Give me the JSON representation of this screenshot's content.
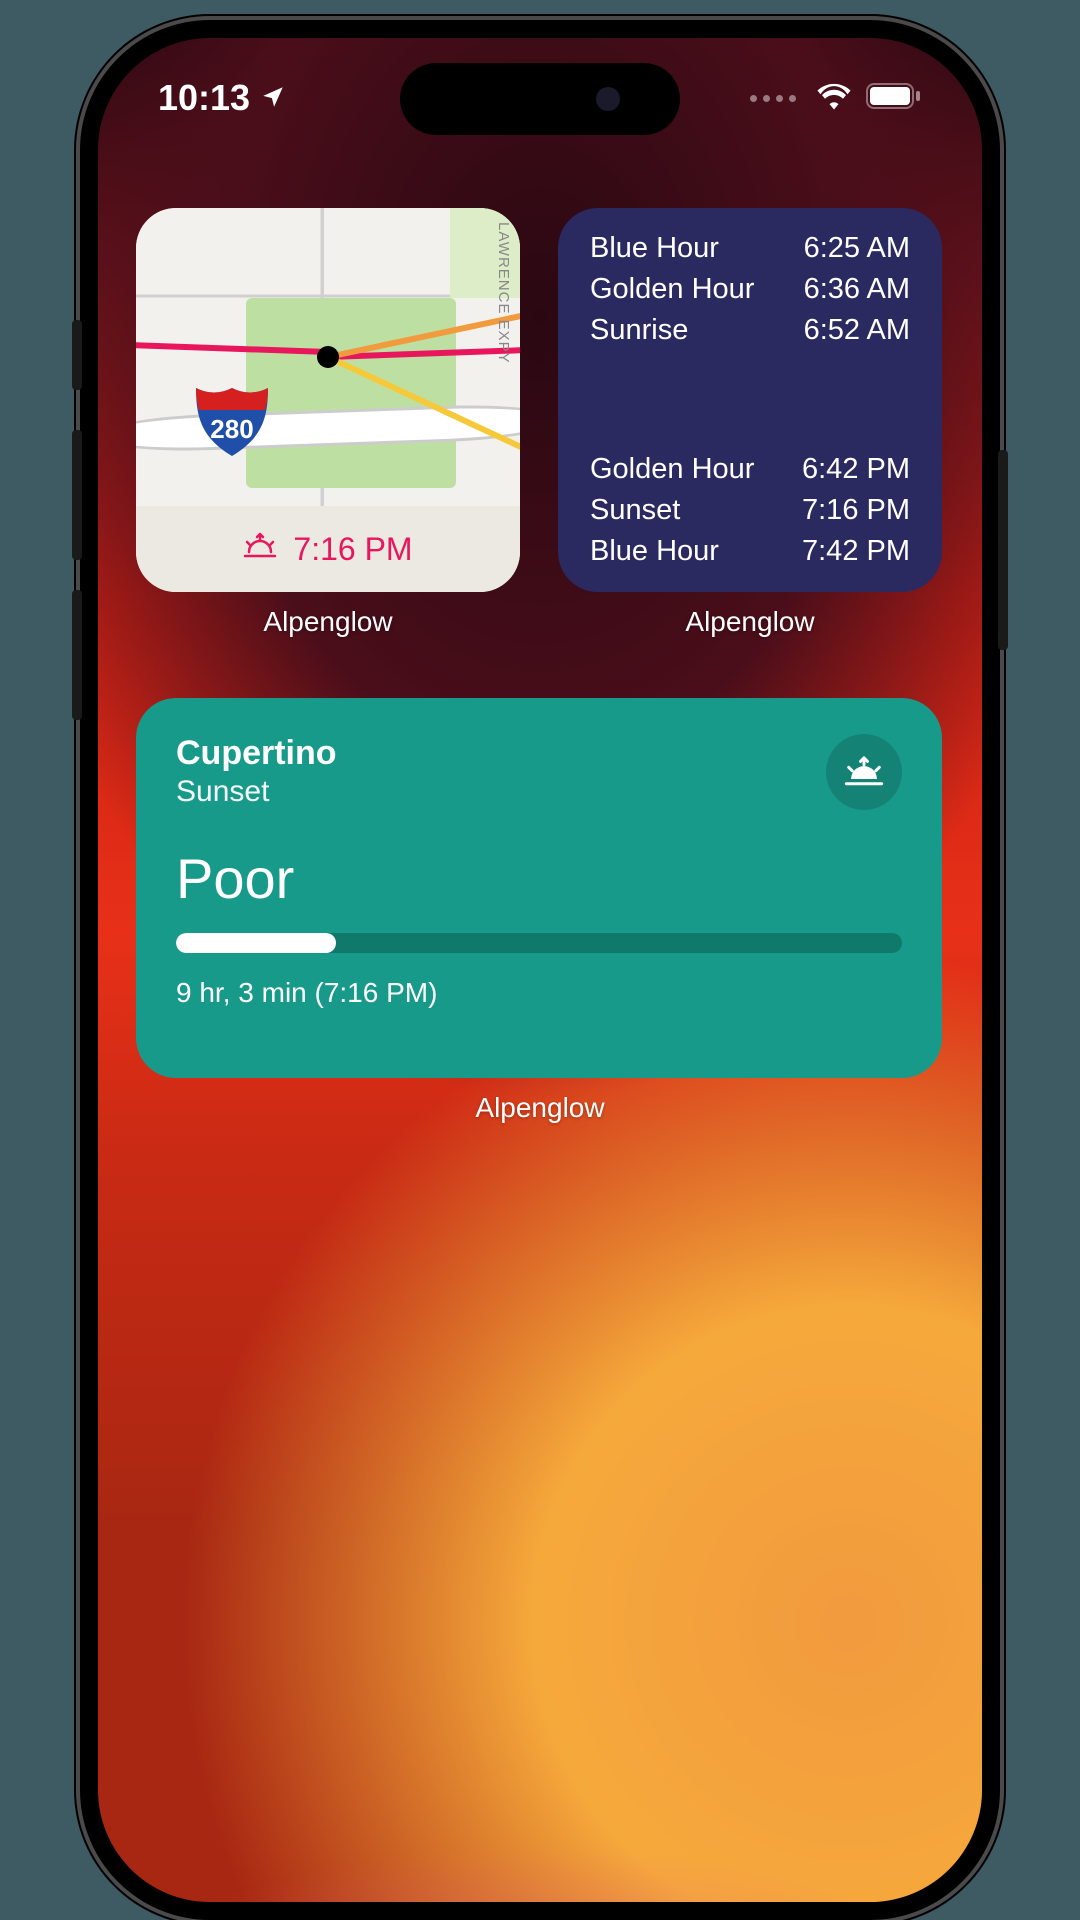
{
  "status": {
    "time": "10:13",
    "location_icon": "location-arrow",
    "wifi_icon": "wifi",
    "battery_icon": "battery-full"
  },
  "widgets": {
    "map": {
      "app_label": "Alpenglow",
      "footer_time": "7:16 PM",
      "highway_shield": "280",
      "road_label": "LAWRENCE EXPY",
      "footer_icon": "sunset-icon"
    },
    "times": {
      "app_label": "Alpenglow",
      "morning": [
        {
          "label": "Blue Hour",
          "value": "6:25 AM"
        },
        {
          "label": "Golden Hour",
          "value": "6:36 AM"
        },
        {
          "label": "Sunrise",
          "value": "6:52 AM"
        }
      ],
      "evening": [
        {
          "label": "Golden Hour",
          "value": "6:42 PM"
        },
        {
          "label": "Sunset",
          "value": "7:16 PM"
        },
        {
          "label": "Blue Hour",
          "value": "7:42 PM"
        }
      ]
    },
    "quality": {
      "app_label": "Alpenglow",
      "location": "Cupertino",
      "event": "Sunset",
      "rating": "Poor",
      "progress_pct": 22,
      "countdown": "9 hr, 3 min (7:16 PM)",
      "icon": "sunset-icon"
    }
  }
}
